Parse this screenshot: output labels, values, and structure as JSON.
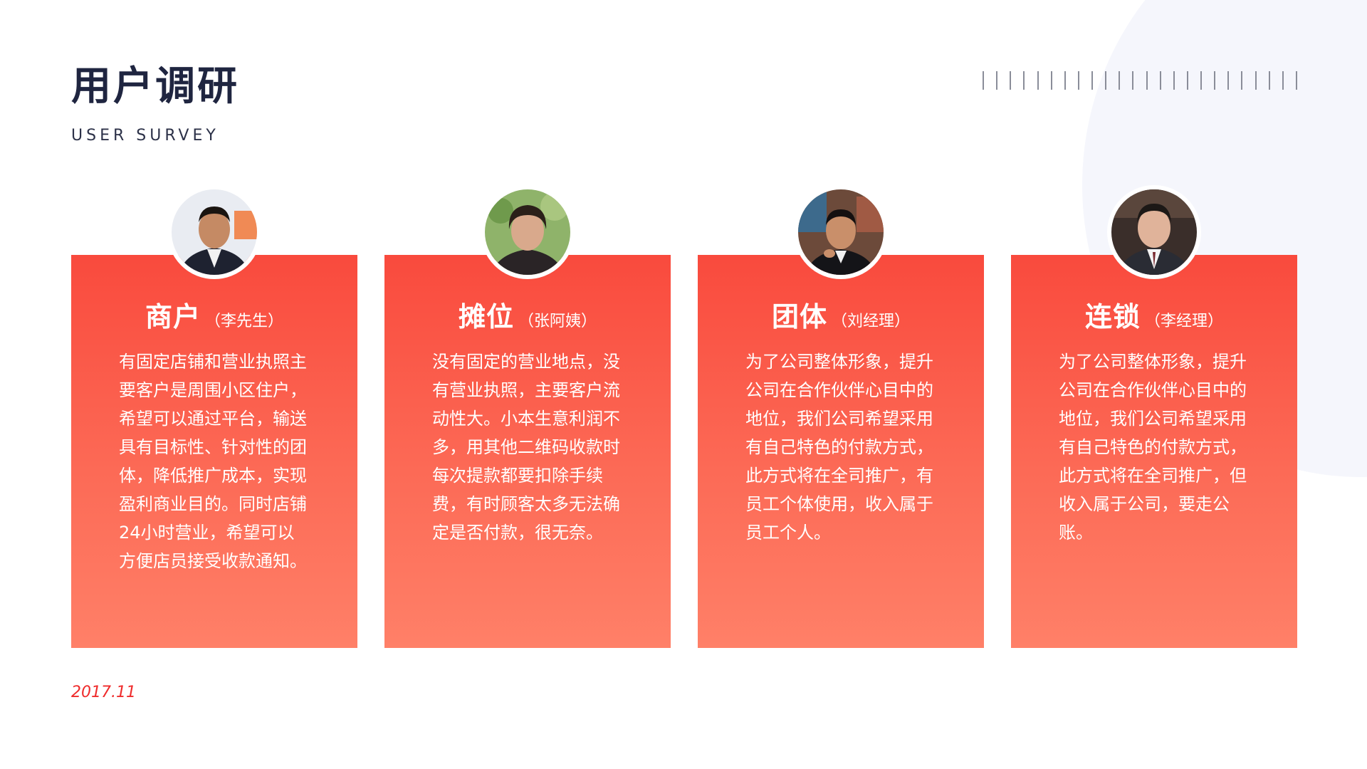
{
  "header": {
    "title": "用户调研",
    "subtitle": "USER SURVEY"
  },
  "colors": {
    "accent": "#f94a3d",
    "accent_light": "#ff8068",
    "title": "#1f2540",
    "date": "#ef2b2b"
  },
  "cards": [
    {
      "role": "商户",
      "person": "（李先生）",
      "avatar": "person-photo-icon",
      "desc": "有固定店铺和营业执照主要客户是周围小区住户，希望可以通过平台，输送具有目标性、针对性的团体，降低推广成本，实现盈利商业目的。同时店铺24小时营业，希望可以方便店员接受收款通知。"
    },
    {
      "role": "摊位",
      "person": "（张阿姨）",
      "avatar": "person-photo-icon",
      "desc": "没有固定的营业地点，没有营业执照，主要客户流动性大。小本生意利润不多，用其他二维码收款时每次提款都要扣除手续费，有时顾客太多无法确定是否付款，很无奈。"
    },
    {
      "role": "团体",
      "person": "（刘经理）",
      "avatar": "person-photo-icon",
      "desc": "为了公司整体形象，提升公司在合作伙伴心目中的地位，我们公司希望采用有自己特色的付款方式，此方式将在全司推广，有员工个体使用，收入属于员工个人。"
    },
    {
      "role": "连锁",
      "person": "（李经理）",
      "avatar": "person-photo-icon",
      "desc": "为了公司整体形象，提升公司在合作伙伴心目中的地位，我们公司希望采用有自己特色的付款方式，此方式将在全司推广，但收入属于公司，要走公账。"
    }
  ],
  "footer": {
    "date": "2017.11"
  }
}
